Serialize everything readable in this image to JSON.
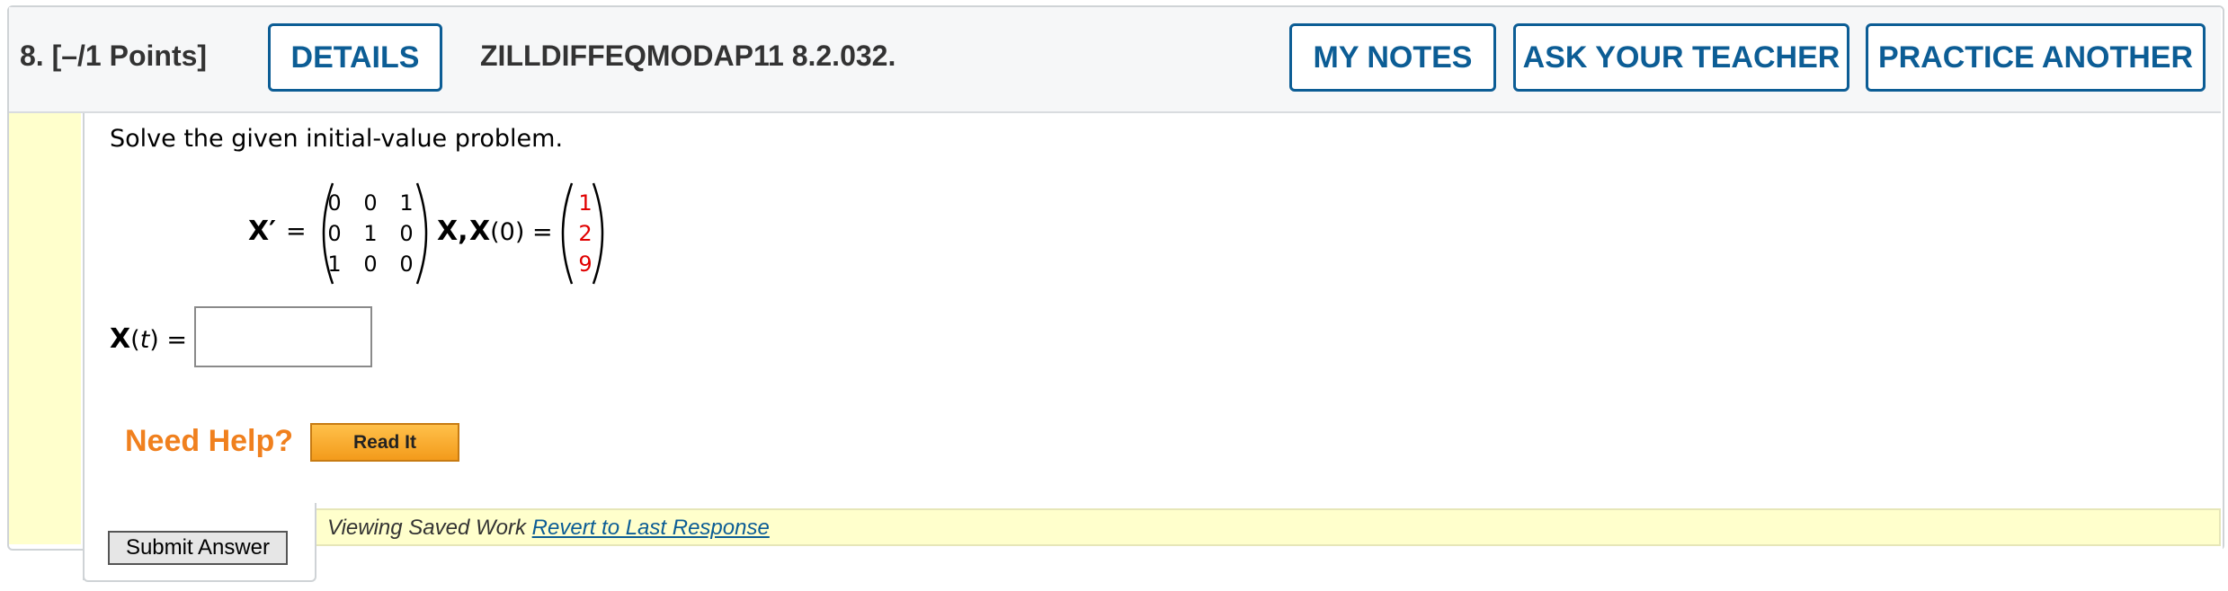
{
  "question": {
    "number_label": "8.",
    "points_label": "[–/1 Points]",
    "code": "ZILLDIFFEQMODAP11 8.2.032.",
    "prompt": "Solve the given initial-value problem."
  },
  "header_buttons": {
    "details": "DETAILS",
    "my_notes": "MY NOTES",
    "ask_teacher": "ASK YOUR TEACHER",
    "practice": "PRACTICE ANOTHER"
  },
  "equation": {
    "lhs": "X′",
    "equals": "=",
    "matrix": [
      [
        "0",
        "0",
        "1"
      ],
      [
        "0",
        "1",
        "0"
      ],
      [
        "1",
        "0",
        "0"
      ]
    ],
    "after_matrix": "X,",
    "initial_label": "X",
    "initial_arg": "(0)",
    "equals2": "=",
    "initial_vector": [
      "1",
      "2",
      "9"
    ]
  },
  "answer": {
    "label_bold": "X",
    "label_rest": "(",
    "var": "t",
    "label_end": ") =",
    "value": "",
    "placeholder": ""
  },
  "help": {
    "need_help": "Need Help?",
    "read_it": "Read It"
  },
  "saved": {
    "text": "Viewing Saved Work",
    "link": "Revert to Last Response"
  },
  "submit_label": "Submit Answer",
  "colors": {
    "brand_blue": "#0c5d95",
    "help_orange": "#f0801e",
    "highlight_yellow": "#ffffcc",
    "initial_red": "#e00000"
  }
}
